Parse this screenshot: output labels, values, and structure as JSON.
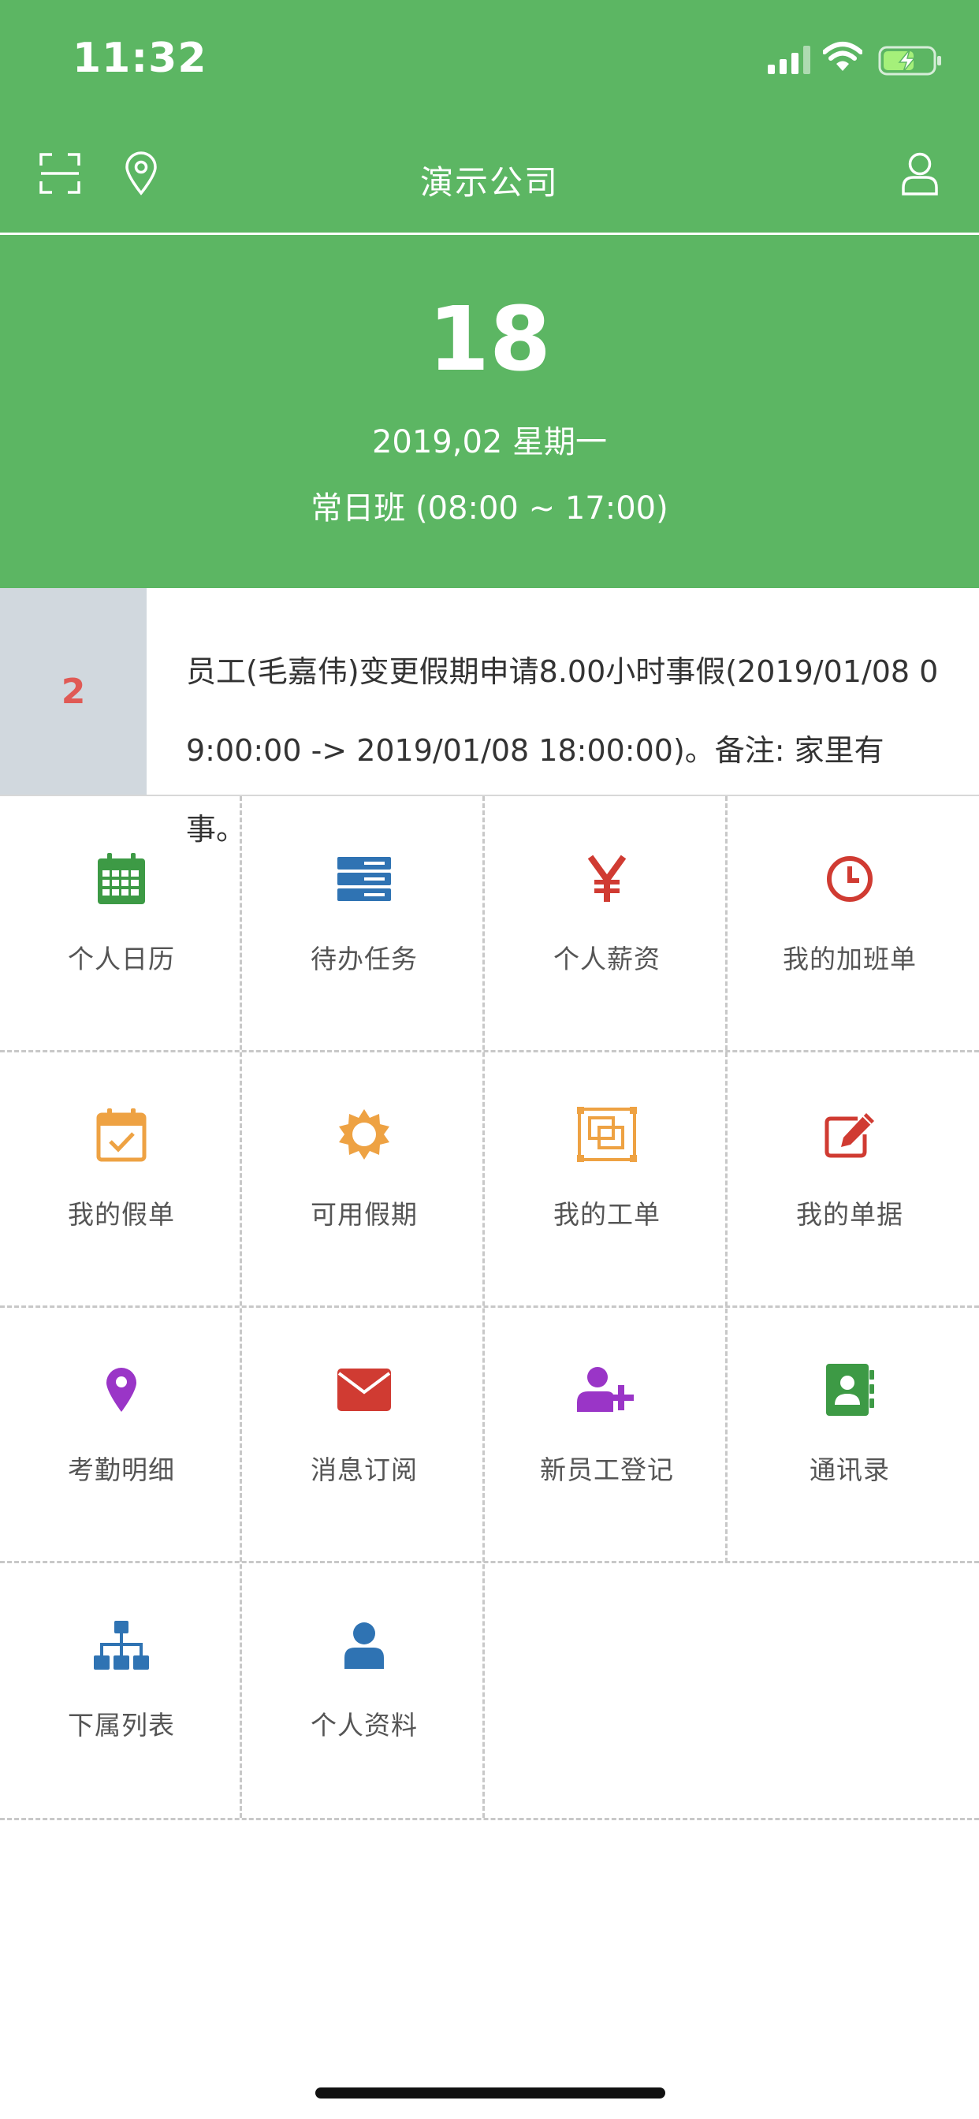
{
  "status": {
    "time": "11:32"
  },
  "nav": {
    "title": "演示公司"
  },
  "date": {
    "day": "18",
    "line": "2019,02 星期一",
    "shift": "常日班 (08:00 ~ 17:00)"
  },
  "notice": {
    "count": "2",
    "text": "员工(毛嘉伟)变更假期申请8.00小时事假(2019/01/08 09:00:00 -> 2019/01/08 18:00:00)。备注: 家里有事。"
  },
  "menu": [
    {
      "label": "个人日历",
      "icon": "calendar-icon",
      "color": "#3d9a45"
    },
    {
      "label": "待办任务",
      "icon": "server-icon",
      "color": "#2f73b3"
    },
    {
      "label": "个人薪资",
      "icon": "yen-icon",
      "color": "#d03b32"
    },
    {
      "label": "我的加班单",
      "icon": "clock-icon",
      "color": "#d03b32"
    },
    {
      "label": "我的假单",
      "icon": "calendar-check-icon",
      "color": "#eea243"
    },
    {
      "label": "可用假期",
      "icon": "sun-icon",
      "color": "#eea243"
    },
    {
      "label": "我的工单",
      "icon": "clone-icon",
      "color": "#eea243"
    },
    {
      "label": "我的单据",
      "icon": "edit-icon",
      "color": "#d03b32"
    },
    {
      "label": "考勤明细",
      "icon": "map-pin-icon",
      "color": "#9a35c7"
    },
    {
      "label": "消息订阅",
      "icon": "envelope-icon",
      "color": "#d03b32"
    },
    {
      "label": "新员工登记",
      "icon": "user-plus-icon",
      "color": "#9a35c7"
    },
    {
      "label": "通讯录",
      "icon": "address-book-icon",
      "color": "#3d9a45"
    },
    {
      "label": "下属列表",
      "icon": "sitemap-icon",
      "color": "#2f73b3"
    },
    {
      "label": "个人资料",
      "icon": "user-icon",
      "color": "#2f73b3"
    }
  ],
  "colors": {
    "header": "#5cb663",
    "notice_badge_bg": "#d1d8de",
    "notice_count": "#e05a55"
  }
}
